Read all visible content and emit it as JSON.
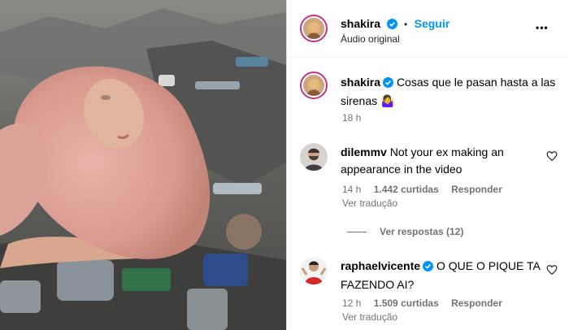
{
  "post": {
    "username": "shakira",
    "follow_label": "Seguir",
    "audio_label": "Áudio original",
    "more_label": "•••"
  },
  "caption": {
    "username": "shakira",
    "text": "Cosas que le pasan hasta a las sirenas 🤷‍♀️",
    "time": "18 h"
  },
  "comments": [
    {
      "username": "dilemmv",
      "text": "Not your ex making an appearance in the video",
      "time": "14 h",
      "likes": "1.442 curtidas",
      "reply_label": "Responder",
      "translate_label": "Ver tradução",
      "replies_label": "Ver respostas (12)"
    },
    {
      "username": "raphaelvicente",
      "text": "O QUE O PIQUE TA FAZENDO AI?",
      "time": "12 h",
      "likes": "1.509 curtidas",
      "reply_label": "Responder",
      "translate_label": "Ver tradução"
    }
  ],
  "colors": {
    "accent": "#0095f6",
    "ring": "#c13584",
    "meta": "#737373"
  },
  "icons": [
    "verified-badge-icon",
    "more-options-icon",
    "heart-icon"
  ]
}
